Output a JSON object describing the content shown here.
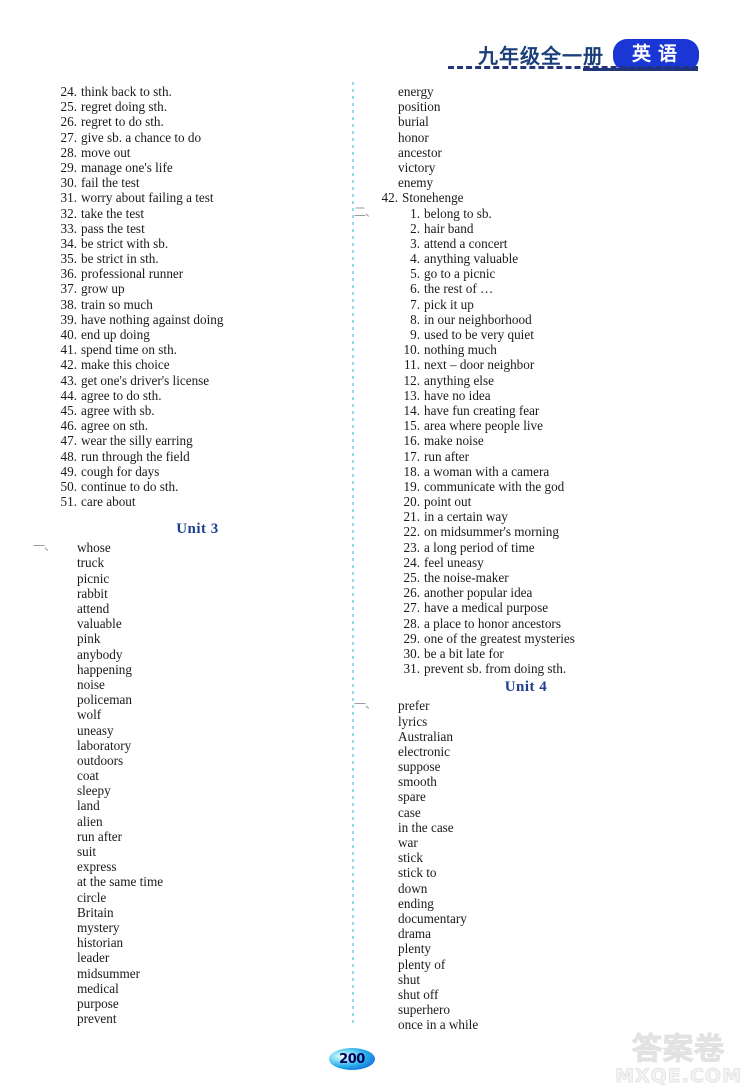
{
  "header": {
    "title": "九年级全一册",
    "badge": "英语"
  },
  "left_column": {
    "phrases": [
      {
        "num": "24.",
        "text": "think back to sth."
      },
      {
        "num": "25.",
        "text": "regret doing sth."
      },
      {
        "num": "26.",
        "text": "regret to do sth."
      },
      {
        "num": "27.",
        "text": "give sb. a chance to do"
      },
      {
        "num": "28.",
        "text": "move out"
      },
      {
        "num": "29.",
        "text": "manage one's life"
      },
      {
        "num": "30.",
        "text": "fail the test"
      },
      {
        "num": "31.",
        "text": "worry about failing a test"
      },
      {
        "num": "32.",
        "text": "take the test"
      },
      {
        "num": "33.",
        "text": "pass the test"
      },
      {
        "num": "34.",
        "text": "be strict with sb."
      },
      {
        "num": "35.",
        "text": "be strict in sth."
      },
      {
        "num": "36.",
        "text": "professional runner"
      },
      {
        "num": "37.",
        "text": "grow up"
      },
      {
        "num": "38.",
        "text": "train so much"
      },
      {
        "num": "39.",
        "text": "have nothing against doing"
      },
      {
        "num": "40.",
        "text": "end up doing"
      },
      {
        "num": "41.",
        "text": "spend time on sth."
      },
      {
        "num": "42.",
        "text": "make this choice"
      },
      {
        "num": "43.",
        "text": "get one's driver's license"
      },
      {
        "num": "44.",
        "text": "agree to do sth."
      },
      {
        "num": "45.",
        "text": "agree with sb."
      },
      {
        "num": "46.",
        "text": "agree on sth."
      },
      {
        "num": "47.",
        "text": "wear the silly earring"
      },
      {
        "num": "48.",
        "text": "run through the field"
      },
      {
        "num": "49.",
        "text": "cough for days"
      },
      {
        "num": "50.",
        "text": "continue to do sth."
      },
      {
        "num": "51.",
        "text": "care about"
      }
    ],
    "unit_heading": {
      "label": "Unit",
      "number": "3"
    },
    "section_marker": "一、",
    "words": [
      "whose",
      "truck",
      "picnic",
      "rabbit",
      "attend",
      "valuable",
      "pink",
      "anybody",
      "happening",
      "noise",
      "policeman",
      "wolf",
      "uneasy",
      "laboratory",
      "outdoors",
      "coat",
      "sleepy",
      "land",
      "alien",
      "run after",
      "suit",
      "express",
      "at the same time",
      "circle",
      "Britain",
      "mystery",
      "historian",
      "leader",
      "midsummer",
      "medical",
      "purpose",
      "prevent"
    ]
  },
  "right_column": {
    "words_top": [
      "energy",
      "position",
      "burial",
      "honor",
      "ancestor",
      "victory",
      "enemy"
    ],
    "last_numbered_word": {
      "num": "42.",
      "text": "Stonehenge"
    },
    "section_marker": "二、",
    "phrases": [
      {
        "num": "1.",
        "text": "belong to sb."
      },
      {
        "num": "2.",
        "text": "hair band"
      },
      {
        "num": "3.",
        "text": "attend a concert"
      },
      {
        "num": "4.",
        "text": "anything valuable"
      },
      {
        "num": "5.",
        "text": "go to a picnic"
      },
      {
        "num": "6.",
        "text": "the rest of …"
      },
      {
        "num": "7.",
        "text": "pick it up"
      },
      {
        "num": "8.",
        "text": "in our neighborhood"
      },
      {
        "num": "9.",
        "text": "used to be very quiet"
      },
      {
        "num": "10.",
        "text": "nothing much"
      },
      {
        "num": "11.",
        "text": "next – door neighbor"
      },
      {
        "num": "12.",
        "text": "anything else"
      },
      {
        "num": "13.",
        "text": "have no idea"
      },
      {
        "num": "14.",
        "text": "have fun creating fear"
      },
      {
        "num": "15.",
        "text": "area where people live"
      },
      {
        "num": "16.",
        "text": "make noise"
      },
      {
        "num": "17.",
        "text": "run after"
      },
      {
        "num": "18.",
        "text": "a woman with a camera"
      },
      {
        "num": "19.",
        "text": "communicate with the god"
      },
      {
        "num": "20.",
        "text": "point out"
      },
      {
        "num": "21.",
        "text": "in a certain way"
      },
      {
        "num": "22.",
        "text": "on midsummer's morning"
      },
      {
        "num": "23.",
        "text": "a long period of time"
      },
      {
        "num": "24.",
        "text": "feel uneasy"
      },
      {
        "num": "25.",
        "text": "the noise-maker"
      },
      {
        "num": "26.",
        "text": "another popular idea"
      },
      {
        "num": "27.",
        "text": "have a medical purpose"
      },
      {
        "num": "28.",
        "text": "a place to honor ancestors"
      },
      {
        "num": "29.",
        "text": "one of the greatest mysteries"
      },
      {
        "num": "30.",
        "text": "be a bit late for"
      },
      {
        "num": "31.",
        "text": "prevent sb. from doing sth."
      }
    ],
    "unit_heading": {
      "label": "Unit",
      "number": "4"
    },
    "section_marker_2": "一、",
    "words": [
      "prefer",
      "lyrics",
      "Australian",
      "electronic",
      "suppose",
      "smooth",
      "spare",
      "case",
      "in the case",
      "war",
      "stick",
      "stick to",
      "down",
      "ending",
      "documentary",
      "drama",
      "plenty",
      "plenty of",
      "shut",
      "shut off",
      "superhero",
      "once in a while"
    ]
  },
  "footer": {
    "page_number": "200",
    "watermark_cn": "答案卷",
    "watermark_en": "MXQE.COM"
  }
}
